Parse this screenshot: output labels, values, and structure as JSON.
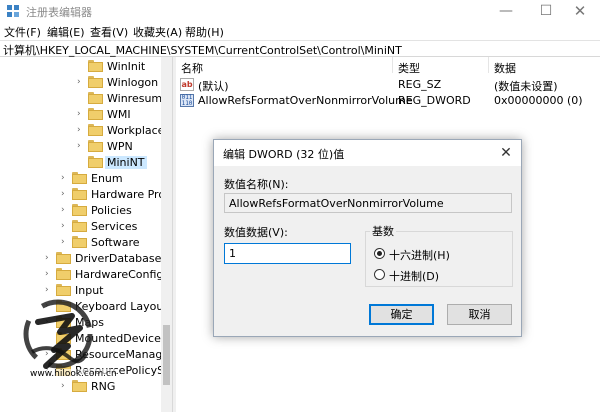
{
  "window": {
    "title": "注册表编辑器",
    "minimize_glyph": "—",
    "maximize_glyph": "☐",
    "close_glyph": "✕"
  },
  "menu": [
    {
      "label": "文件(F)"
    },
    {
      "label": "编辑(E)"
    },
    {
      "label": "查看(V)"
    },
    {
      "label": "收藏夹(A)"
    },
    {
      "label": "帮助(H)"
    }
  ],
  "address": "计算机\\HKEY_LOCAL_MACHINE\\SYSTEM\\CurrentControlSet\\Control\\MiniNT",
  "tree": [
    {
      "label": "WinInit",
      "expandable": false
    },
    {
      "label": "Winlogon",
      "expandable": true
    },
    {
      "label": "Winresume",
      "expandable": false
    },
    {
      "label": "WMI",
      "expandable": true
    },
    {
      "label": "Workplace",
      "expandable": true
    },
    {
      "label": "WPN",
      "expandable": true
    },
    {
      "label": "MiniNT",
      "expandable": false,
      "selected": true
    },
    {
      "label": "Enum",
      "expandable": true
    },
    {
      "label": "Hardware Prof",
      "expandable": true
    },
    {
      "label": "Policies",
      "expandable": true
    },
    {
      "label": "Services",
      "expandable": true
    },
    {
      "label": "Software",
      "expandable": true
    },
    {
      "label": "DriverDatabase",
      "expandable": true
    },
    {
      "label": "HardwareConfig",
      "expandable": true
    },
    {
      "label": "Input",
      "expandable": true
    },
    {
      "label": "Keyboard Layout",
      "expandable": true
    },
    {
      "label": "Maps",
      "expandable": true
    },
    {
      "label": "MountedDevices",
      "expandable": false
    },
    {
      "label": "ResourceManager",
      "expandable": true
    },
    {
      "label": "ResourcePolicyStore",
      "expandable": true
    },
    {
      "label": "RNG",
      "expandable": true
    }
  ],
  "list": {
    "columns": [
      "名称",
      "类型",
      "数据"
    ],
    "rows": [
      {
        "icon": "ab",
        "name": "(默认)",
        "type": "REG_SZ",
        "data": "(数值未设置)"
      },
      {
        "icon": "bin",
        "name": "AllowRefsFormatOverNonmirrorVolume",
        "type": "REG_DWORD",
        "data": "0x00000000 (0)"
      }
    ]
  },
  "dialog": {
    "title": "编辑 DWORD (32 位)值",
    "close_glyph": "✕",
    "name_label": "数值名称(N):",
    "name_value": "AllowRefsFormatOverNonmirrorVolume",
    "data_label": "数值数据(V):",
    "data_value": "1",
    "base_label": "基数",
    "radio_hex": "十六进制(H)",
    "radio_dec": "十进制(D)",
    "ok": "确定",
    "cancel": "取消"
  },
  "watermark": {
    "url": "www.hilook.com.cn"
  }
}
